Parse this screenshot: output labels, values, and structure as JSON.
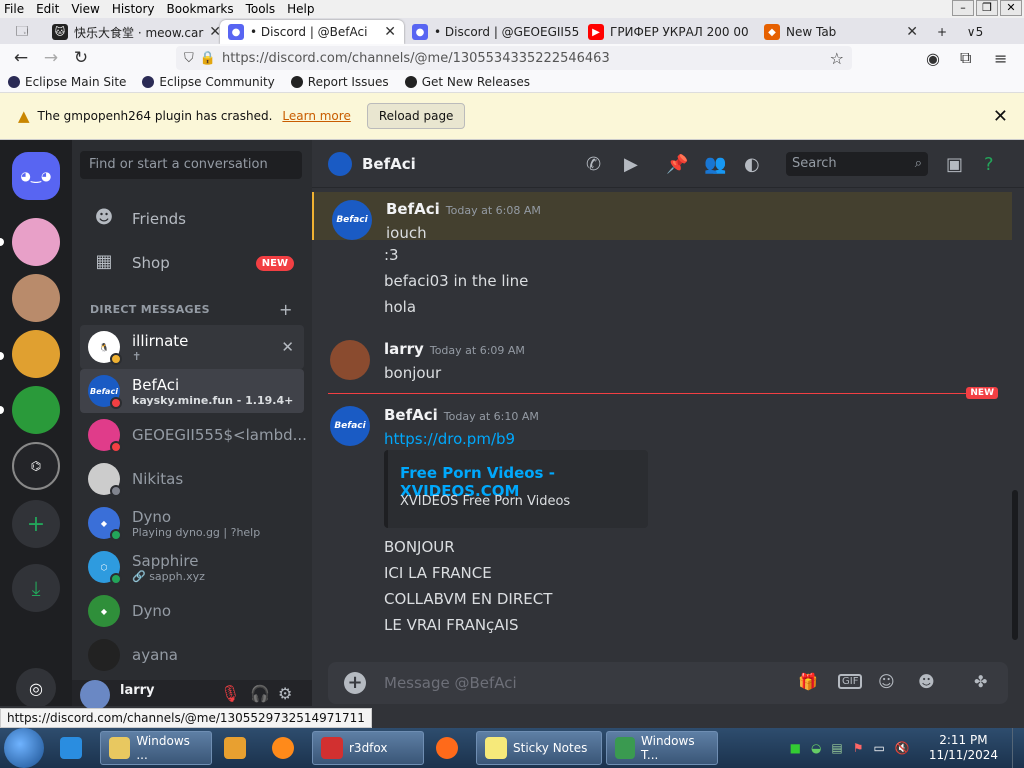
{
  "menubar": {
    "items": [
      "File",
      "Edit",
      "View",
      "History",
      "Bookmarks",
      "Tools",
      "Help"
    ]
  },
  "tabs": [
    {
      "label": "快乐大食堂 · meow.car",
      "color": "#222"
    },
    {
      "label": "• Discord | @BefAci",
      "color": "#5865f2"
    },
    {
      "label": "• Discord | @GEOEGII55",
      "color": "#5865f2"
    },
    {
      "label": "ГРИФЕР УКРАЛ 200 00",
      "color": "#ff0000"
    },
    {
      "label": "New Tab",
      "color": "#e66000"
    }
  ],
  "tab_overflow_count": "5",
  "navbar": {
    "url": "https://discord.com/channels/@me/1305534335222546463"
  },
  "bookmarks": [
    "Eclipse Main Site",
    "Eclipse Community",
    "Report Issues",
    "Get New Releases"
  ],
  "notification": {
    "message": "The gmpopenh264 plugin has crashed.",
    "learn_more": "Learn more",
    "reload": "Reload page"
  },
  "dm_sidebar": {
    "search_placeholder": "Find or start a conversation",
    "friends": "Friends",
    "shop": "Shop",
    "shop_badge": "NEW",
    "header": "DIRECT MESSAGES",
    "dms": [
      {
        "name": "illirnate",
        "sub": "✝",
        "color": "#ffffff",
        "status": "#f0b232"
      },
      {
        "name": "BefAci",
        "sub": "kaysky.mine.fun - 1.19.4+",
        "color": "#1a5bc4",
        "status": "#f23f43"
      },
      {
        "name": "GEOEGII555$<lambd...",
        "sub": "",
        "color": "#e03c8a",
        "status": "#f23f43"
      },
      {
        "name": "Nikitas",
        "sub": "",
        "color": "#ccc",
        "status": "#80848e"
      },
      {
        "name": "Dyno",
        "sub": "Playing dyno.gg | ?help",
        "color": "#3a6fd8",
        "status": "#23a55a"
      },
      {
        "name": "Sapphire",
        "sub": "🔗 sapph.xyz",
        "color": "#2e9bdf",
        "status": "#23a55a"
      },
      {
        "name": "Dyno",
        "sub": "",
        "color": "#2f8f3a",
        "status": ""
      },
      {
        "name": "ayana",
        "sub": "",
        "color": "#222",
        "status": ""
      }
    ]
  },
  "user_panel": {
    "name": "larry"
  },
  "chat": {
    "title": "BefAci",
    "search_placeholder": "Search",
    "messages": [
      {
        "author": "BefAci",
        "time": "Today at 6:08 AM",
        "lines": [
          "iouch",
          ":3",
          "befaci03 in the line",
          "hola"
        ]
      },
      {
        "author": "larry",
        "time": "Today at 6:09 AM",
        "lines": [
          "bonjour"
        ]
      },
      {
        "author": "BefAci",
        "time": "Today at 6:10 AM",
        "link": "https://dro.pm/b9",
        "embed": {
          "title": "Free Porn Videos - XVIDEOS.COM",
          "desc": "XVIDEOS Free Porn Videos"
        },
        "lines": [
          "BONJOUR",
          "ICI LA FRANCE",
          "COLLABVM EN DIRECT",
          "LE VRAI FRANçAIS"
        ]
      }
    ],
    "new_label": "NEW",
    "composer_placeholder": "Message @BefAci",
    "gif_label": "GIF"
  },
  "status_url": "https://discord.com/channels/@me/1305529732514971711",
  "taskbar": {
    "items": [
      "Windows ...",
      "",
      "",
      "r3dfox",
      "",
      "Sticky Notes",
      "Windows T..."
    ],
    "time": "2:11 PM",
    "date": "11/11/2024"
  }
}
